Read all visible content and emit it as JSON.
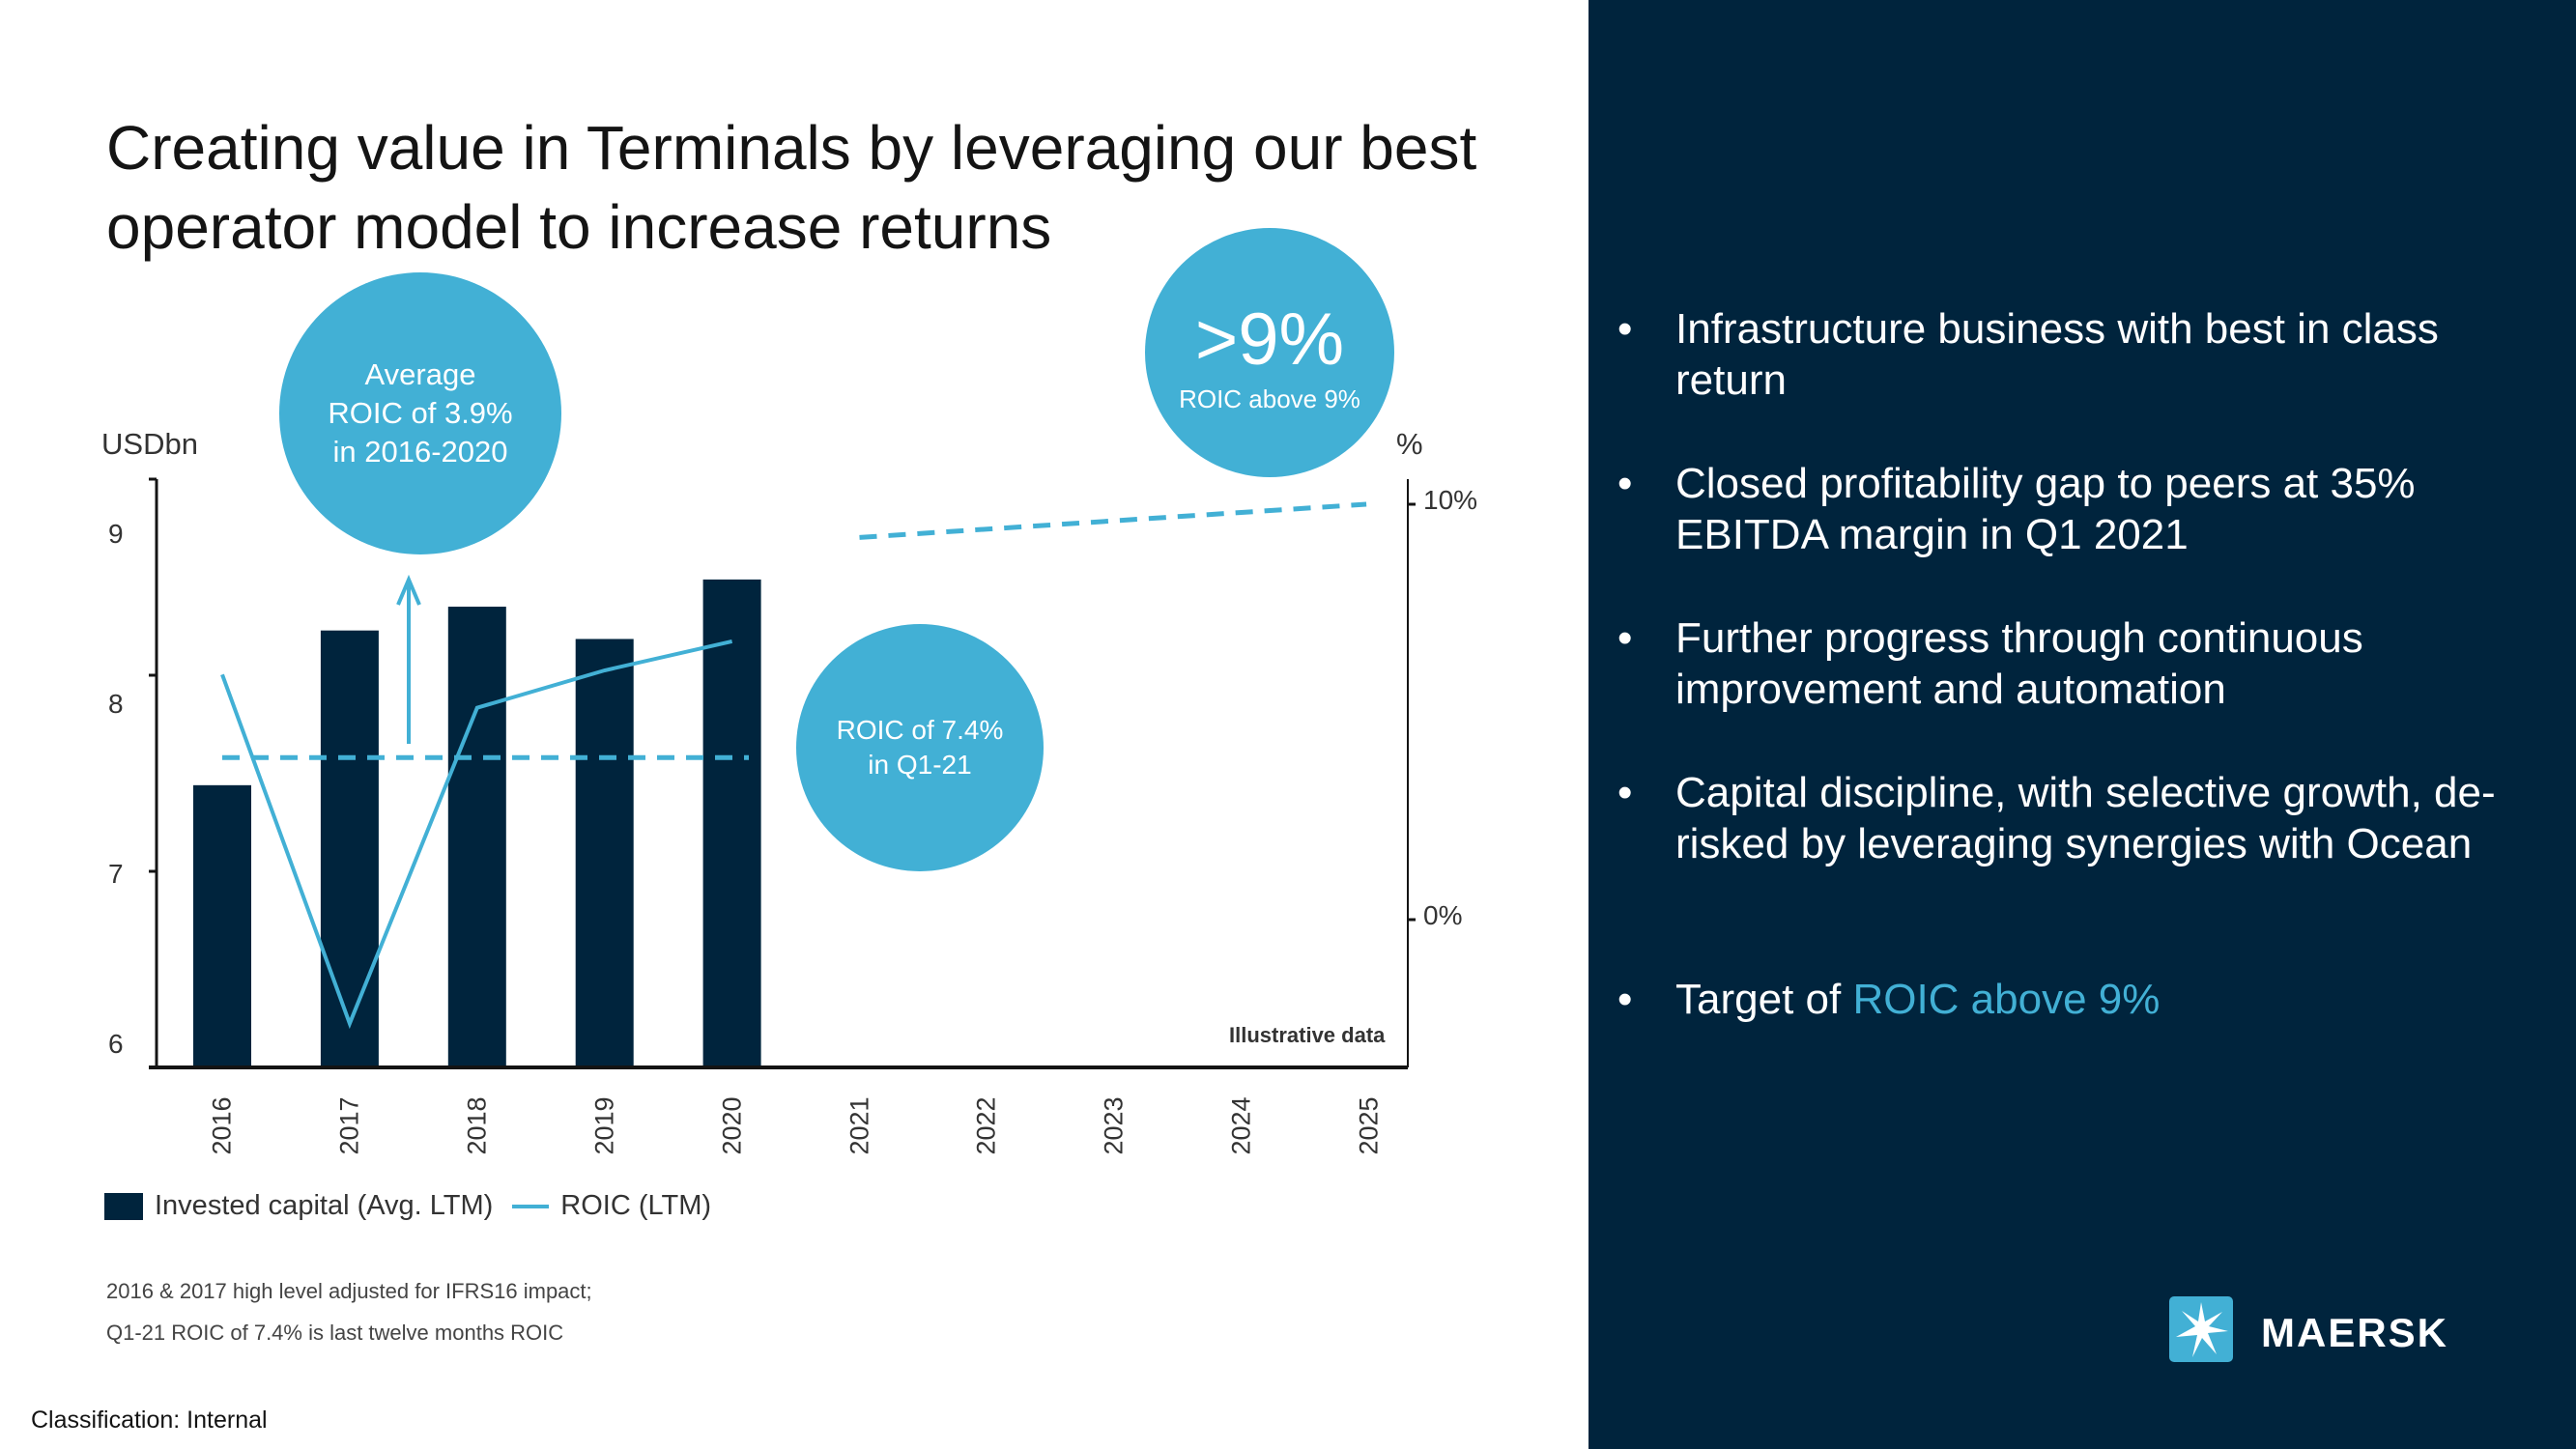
{
  "title": "Creating value in Terminals by leveraging our best operator model to increase returns",
  "colors": {
    "navy": "#00243d",
    "accent": "#42b0d5"
  },
  "callouts": {
    "average": "Average ROIC of 3.9% in 2016-2020",
    "target_big": ">9%",
    "target_small": "ROIC above 9%",
    "q1": "ROIC of 7.4% in Q1-21"
  },
  "chart_data": {
    "type": "bar",
    "categories": [
      "2016",
      "2017",
      "2018",
      "2019",
      "2020",
      "2021",
      "2022",
      "2023",
      "2024",
      "2025"
    ],
    "ylabel": "USDbn",
    "y2label": "%",
    "ylim": [
      6,
      9.5
    ],
    "yticks": [
      "6",
      "7",
      "8",
      "9"
    ],
    "y2ticks": [
      "0%",
      "10%"
    ],
    "y2lim": [
      -3,
      10
    ],
    "annotation": "Illustrative data",
    "series": [
      {
        "name": "Invested capital (Avg. LTM)",
        "type": "bar",
        "axis": "left",
        "values": [
          7.66,
          8.57,
          8.71,
          8.52,
          8.87,
          null,
          null,
          null,
          null,
          null
        ]
      },
      {
        "name": "ROIC (LTM)",
        "type": "line",
        "axis": "right",
        "values": [
          5.9,
          -2.5,
          5.1,
          6.0,
          6.7,
          null,
          null,
          null,
          null,
          null
        ]
      }
    ],
    "reference_lines": [
      {
        "style": "dashed",
        "axis": "right",
        "from": "2016",
        "to": "2020",
        "values": [
          3.9,
          3.9
        ]
      },
      {
        "style": "dashed",
        "axis": "right",
        "from": "2021",
        "to": "2025",
        "values": [
          9.2,
          10.0
        ]
      }
    ],
    "legend": "bottom-left"
  },
  "bullets": [
    {
      "text": "Infrastructure business with best in class return"
    },
    {
      "text": "Closed profitability gap to peers at 35% EBITDA margin in Q1 2021"
    },
    {
      "text": "Further progress through continuous improvement and automation"
    },
    {
      "text": "Capital discipline, with selective growth, de-risked by leveraging synergies with Ocean"
    },
    {
      "text": "Target of ",
      "highlight": "ROIC above 9%"
    }
  ],
  "bullet_char": "•",
  "footnotes": [
    "2016 & 2017 high level adjusted for IFRS16 impact;",
    "Q1-21 ROIC of 7.4% is last twelve months ROIC"
  ],
  "classification": "Classification: Internal",
  "logo": {
    "text": "MAERSK",
    "icon": "seven-point-star-icon"
  }
}
